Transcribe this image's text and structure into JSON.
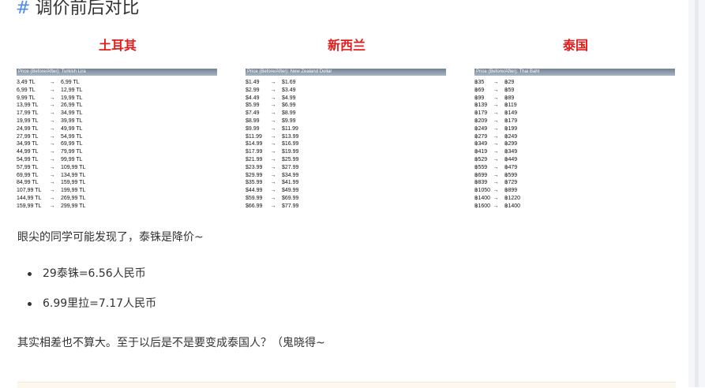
{
  "heading": {
    "hash": "#",
    "title": "调价前后对比"
  },
  "columns": [
    {
      "title": "土耳其",
      "header": "Price (Before/After): Turkish Lira",
      "rows": [
        [
          "3,49 TL",
          "6,99 TL"
        ],
        [
          "6,99 TL",
          "12,99 TL"
        ],
        [
          "9,99 TL",
          "19,99 TL"
        ],
        [
          "13,99 TL",
          "26,99 TL"
        ],
        [
          "17,99 TL",
          "34,99 TL"
        ],
        [
          "19,99 TL",
          "39,99 TL"
        ],
        [
          "24,99 TL",
          "49,99 TL"
        ],
        [
          "27,99 TL",
          "54,99 TL"
        ],
        [
          "34,99 TL",
          "69,99 TL"
        ],
        [
          "44,99 TL",
          "79,99 TL"
        ],
        [
          "54,99 TL",
          "99,99 TL"
        ],
        [
          "57,99 TL",
          "109,99 TL"
        ],
        [
          "69,99 TL",
          "134,99 TL"
        ],
        [
          "84,99 TL",
          "159,99 TL"
        ],
        [
          "107,99 TL",
          "199,99 TL"
        ],
        [
          "144,99 TL",
          "269,99 TL"
        ],
        [
          "159,99 TL",
          "299,99 TL"
        ]
      ]
    },
    {
      "title": "新西兰",
      "header": "Price (Before/After): New Zealand Dollar",
      "rows": [
        [
          "$1.49",
          "$1.69"
        ],
        [
          "$2.99",
          "$3.49"
        ],
        [
          "$4.49",
          "$4.99"
        ],
        [
          "$5.99",
          "$6.99"
        ],
        [
          "$7.49",
          "$8.99"
        ],
        [
          "$8.99",
          "$9.99"
        ],
        [
          "$9.99",
          "$11.99"
        ],
        [
          "$11.99",
          "$13.99"
        ],
        [
          "$14.99",
          "$16.99"
        ],
        [
          "$17.99",
          "$19.99"
        ],
        [
          "$21.99",
          "$25.99"
        ],
        [
          "$23.99",
          "$27.99"
        ],
        [
          "$29.99",
          "$34.99"
        ],
        [
          "$35.99",
          "$41.99"
        ],
        [
          "$44.99",
          "$49.99"
        ],
        [
          "$59.99",
          "$69.99"
        ],
        [
          "$66.99",
          "$77.99"
        ]
      ]
    },
    {
      "title": "泰国",
      "header": "Price (Before/After): Thai Baht",
      "rows": [
        [
          "฿35",
          "฿29"
        ],
        [
          "฿69",
          "฿59"
        ],
        [
          "฿99",
          "฿89"
        ],
        [
          "฿139",
          "฿119"
        ],
        [
          "฿179",
          "฿149"
        ],
        [
          "฿209",
          "฿179"
        ],
        [
          "฿249",
          "฿199"
        ],
        [
          "฿279",
          "฿249"
        ],
        [
          "฿349",
          "฿299"
        ],
        [
          "฿419",
          "฿349"
        ],
        [
          "฿529",
          "฿449"
        ],
        [
          "฿559",
          "฿479"
        ],
        [
          "฿699",
          "฿599"
        ],
        [
          "฿839",
          "฿729"
        ],
        [
          "฿1050",
          "฿899"
        ],
        [
          "฿1400",
          "฿1220"
        ],
        [
          "฿1600",
          "฿1400"
        ]
      ]
    }
  ],
  "arrow": "→",
  "para1": "眼尖的同学可能发现了，泰铢是降价~",
  "bullets": [
    "29泰铢=6.56人民币",
    "6.99里拉=7.17人民币"
  ],
  "para2": "其实相差也不算大。至于以后是不是要变成泰国人？（鬼晓得~"
}
